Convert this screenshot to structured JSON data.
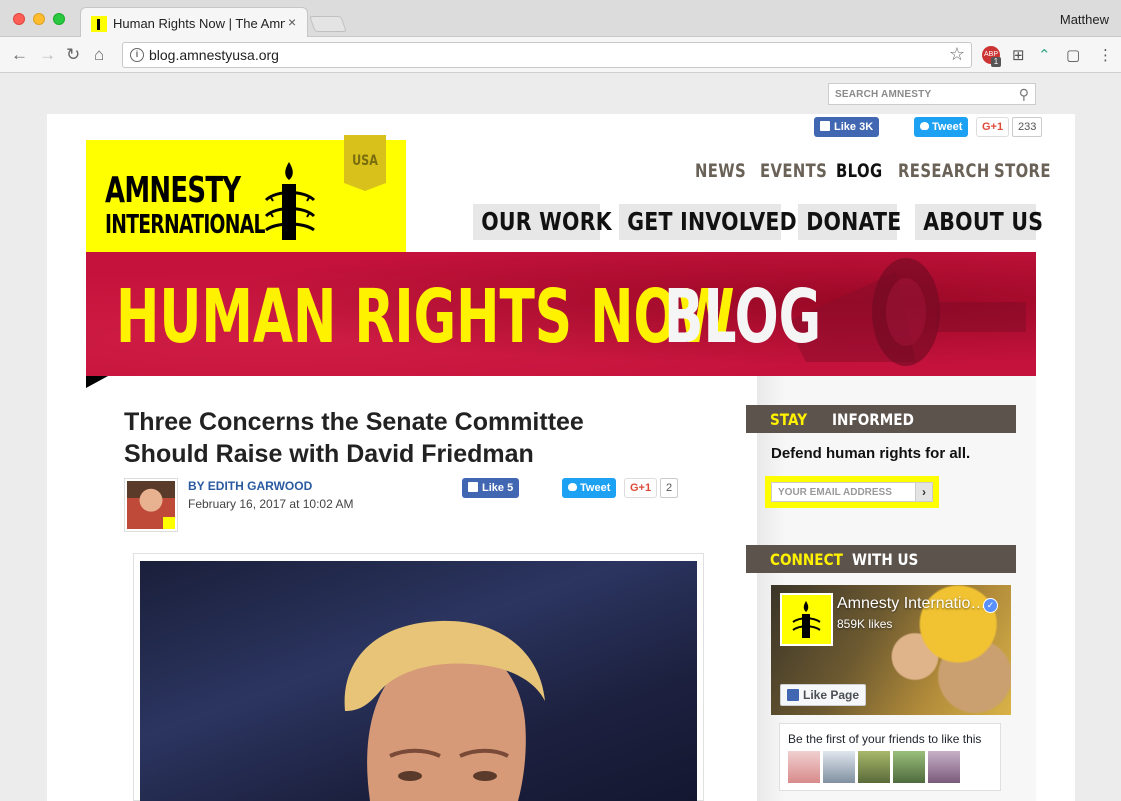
{
  "browser": {
    "tab_title": "Human Rights Now | The Amnesty",
    "tab_close": "×",
    "user": "Matthew",
    "url": "blog.amnestyusa.org",
    "abp_label": "ABP",
    "abp_count": "1"
  },
  "search": {
    "placeholder": "SEARCH AMNESTY"
  },
  "social_top": {
    "like_label": "Like",
    "like_count": "3K",
    "tweet_label": "Tweet",
    "gplus_label": "G+1",
    "gplus_count": "233"
  },
  "logo": {
    "line1": "AMNESTY",
    "line2": "INTERNATIONAL",
    "country": "USA"
  },
  "top_nav": [
    {
      "label": "NEWS",
      "active": false
    },
    {
      "label": "EVENTS",
      "active": false
    },
    {
      "label": "BLOG",
      "active": true
    },
    {
      "label": "RESEARCH",
      "active": false
    },
    {
      "label": "STORE",
      "active": false
    }
  ],
  "main_nav": [
    {
      "label": "OUR WORK"
    },
    {
      "label": "GET INVOLVED"
    },
    {
      "label": "DONATE"
    },
    {
      "label": "ABOUT US"
    }
  ],
  "banner": {
    "yellow": "HUMAN RIGHTS NOW",
    "white": "BLOG"
  },
  "post": {
    "title": "Three Concerns the Senate Committee Should Raise with David Friedman",
    "author": "BY EDITH GARWOOD",
    "date": "February 16, 2017 at 10:02 AM",
    "like_label": "Like",
    "like_count": "5",
    "tweet_label": "Tweet",
    "gplus_label": "G+1",
    "gplus_count": "2"
  },
  "stay_informed": {
    "header_yellow": "STAY",
    "header_white": "INFORMED",
    "text": "Defend human rights for all.",
    "email_placeholder": "YOUR EMAIL ADDRESS",
    "submit": "›"
  },
  "connect": {
    "header_yellow": "CONNECT",
    "header_white": "WITH US",
    "page_name": "Amnesty International USA",
    "likes": "859K likes",
    "like_page_label": "Like Page",
    "friends_text": "Be the first of your friends to like this"
  },
  "colors": {
    "amnesty_yellow": "#ffff00",
    "banner_red": "#c4123c",
    "widget_header": "#5c534d",
    "facebook_blue": "#4267b2",
    "twitter_blue": "#1da1f2"
  }
}
